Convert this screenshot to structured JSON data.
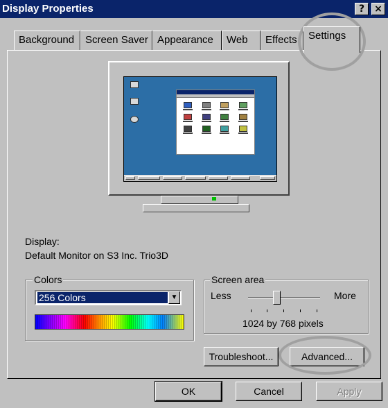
{
  "window": {
    "title": "Display Properties",
    "help_label": "?",
    "close_label": "×"
  },
  "tabs": [
    {
      "label": "Background"
    },
    {
      "label": "Screen Saver"
    },
    {
      "label": "Appearance"
    },
    {
      "label": "Web"
    },
    {
      "label": "Effects"
    },
    {
      "label": "Settings",
      "active": true
    }
  ],
  "display": {
    "label": "Display:",
    "monitor": "Default Monitor on S3 Inc. Trio3D"
  },
  "colors": {
    "legend": "Colors",
    "selected": "256 Colors"
  },
  "screen_area": {
    "legend": "Screen area",
    "less_label": "Less",
    "more_label": "More",
    "resolution": "1024 by 768 pixels",
    "slider_position": 0.4
  },
  "buttons": {
    "troubleshoot": "Troubleshoot...",
    "advanced": "Advanced...",
    "ok": "OK",
    "cancel": "Cancel",
    "apply": "Apply"
  },
  "icons": {
    "monitor": "monitor-preview-icon",
    "dropdown": "chevron-down-icon"
  },
  "colors_palette": {
    "title_bar": "#0a246a",
    "desktop": "#2c6ea6",
    "face": "#c0c0c0",
    "highlight_ring": "#a0a0a0"
  }
}
